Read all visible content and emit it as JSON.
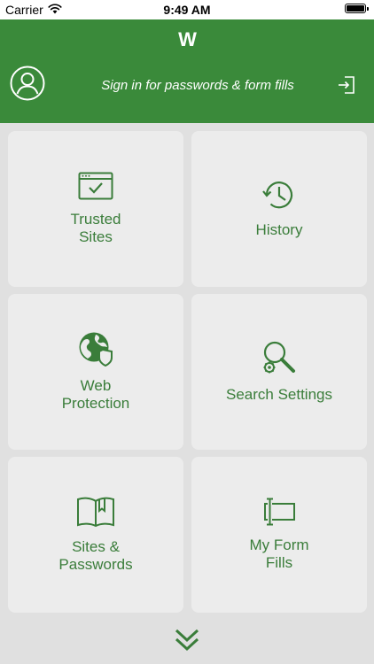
{
  "status_bar": {
    "carrier": "Carrier",
    "time": "9:49 AM"
  },
  "header": {
    "logo": "W",
    "signin_prompt": "Sign in for passwords & form fills"
  },
  "tiles": [
    {
      "label": "Trusted\nSites",
      "icon": "browser-check-icon"
    },
    {
      "label": "History",
      "icon": "history-clock-icon"
    },
    {
      "label": "Web\nProtection",
      "icon": "globe-shield-icon"
    },
    {
      "label": "Search Settings",
      "icon": "search-gear-icon"
    },
    {
      "label": "Sites &\nPasswords",
      "icon": "book-bookmark-icon"
    },
    {
      "label": "My Form\nFills",
      "icon": "text-field-icon"
    }
  ],
  "colors": {
    "brand_green": "#3a8a3a",
    "tile_text_green": "#3a7d3a",
    "tile_background": "#ececec",
    "page_background": "#e0e0e0"
  }
}
